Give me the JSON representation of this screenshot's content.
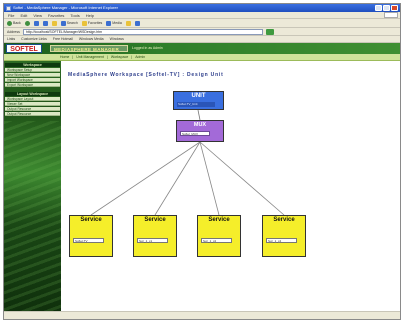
{
  "window": {
    "title": "Softel - MediaSphere Manager - Microsoft Internet Explorer"
  },
  "menu": [
    "File",
    "Edit",
    "View",
    "Favorites",
    "Tools",
    "Help"
  ],
  "toolbar": {
    "back": "Back",
    "forward": "",
    "search": "Search",
    "favorites": "Favorites",
    "media": "Media"
  },
  "address": {
    "label": "Address",
    "url": "http://localhost/SOFTEL/Manager/WSDesign.htm"
  },
  "links": {
    "label": "Links",
    "items": [
      "Customize Links",
      "Free Hotmail",
      "Windows Media",
      "Windows"
    ]
  },
  "app": {
    "logo": "SOFTEL",
    "product": "MEDIASPHERE MANAGER",
    "logged_in": "Logged in as Admin",
    "nav": [
      "Home",
      "Unit Management",
      "Workspace",
      "Admin"
    ]
  },
  "sidebar": {
    "sections": [
      {
        "heading": "Workspace",
        "items": [
          "Workspace Setup",
          "New Workspace",
          "Import Workspace",
          "Export Workspace"
        ]
      },
      {
        "heading": "Layout Workspace",
        "items": [
          "Workspace Layout",
          "Viewer Set",
          "Output Resource",
          "Output Resource"
        ]
      }
    ]
  },
  "workspace": {
    "title": "MediaSphere Workspace [Softel-TV] : Design Unit",
    "unit": {
      "label": "UNIT",
      "value": "Softel-TV_Unit"
    },
    "mux": {
      "label": "MUX",
      "value": "Softel_MUX"
    },
    "services": [
      {
        "label": "Service",
        "value": "Softel-TV"
      },
      {
        "label": "Service",
        "value": "Svc_1_c1"
      },
      {
        "label": "Service",
        "value": "Svc_1_c2"
      },
      {
        "label": "Service",
        "value": "Svc_1_c4"
      }
    ]
  }
}
